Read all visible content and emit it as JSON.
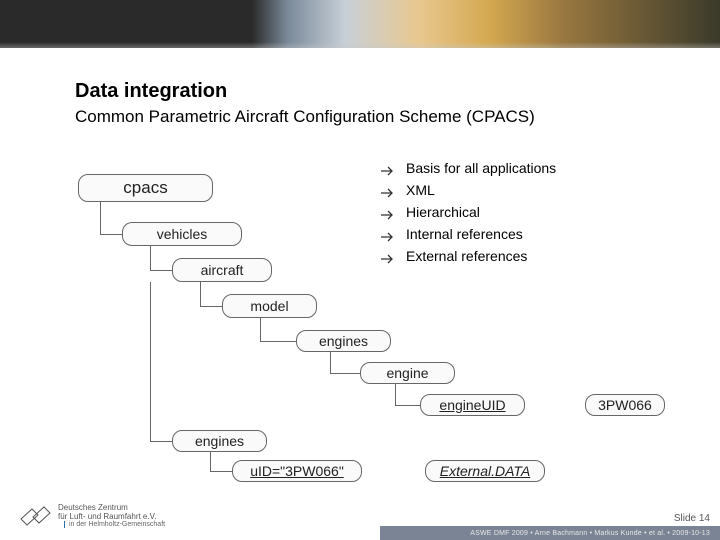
{
  "title": "Data integration",
  "subtitle": "Common Parametric Aircraft Configuration Scheme (CPACS)",
  "bullets": [
    "Basis for all applications",
    "XML",
    "Hierarchical",
    "Internal references",
    "External references"
  ],
  "nodes": {
    "cpacs": "cpacs",
    "vehicles": "vehicles",
    "aircraft": "aircraft",
    "model": "model",
    "engines1": "engines",
    "engine": "engine",
    "engineUID": "engineUID",
    "pw066": "3PW066",
    "engines2": "engines",
    "uid": "uID=\"3PW066\"",
    "external": "External.DATA"
  },
  "footer": {
    "slide": "Slide 14",
    "bar": "ASWE DMF 2009 • Arne Bachmann • Markus Kunde • et al. • 2009-10-13",
    "org1": "Deutsches Zentrum",
    "org2": "für Luft- und Raumfahrt e.V.",
    "helm": "in der Helmholtz-Gemeinschaft"
  }
}
